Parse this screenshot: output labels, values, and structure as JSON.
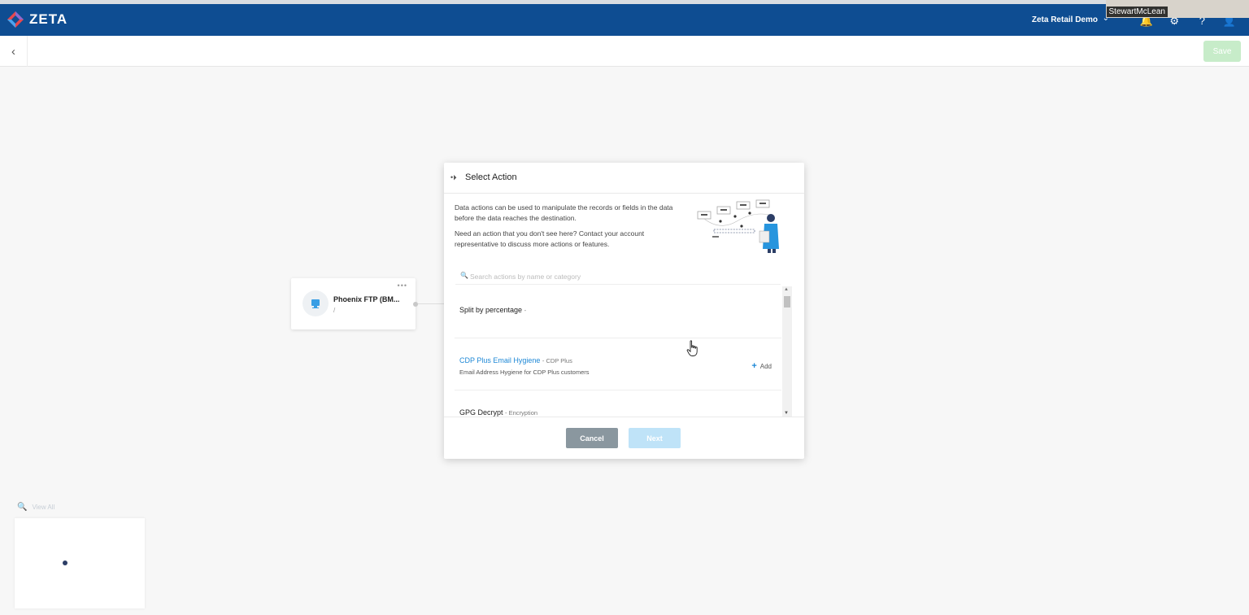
{
  "header": {
    "logo_text": "ZETA",
    "org_name": "Zeta Retail Demo",
    "video_participant": "StewartMcLean"
  },
  "toolbar": {
    "save_label": "Save"
  },
  "node": {
    "title": "Phoenix FTP (BM...",
    "subtitle": "/",
    "menu": "•••"
  },
  "modal": {
    "title": "Select Action",
    "description": "Data actions can be used to manipulate the records or fields in the data before the data reaches the destination.",
    "help_text": "Need an action that you don't see here? Contact your account representative to discuss more actions or features.",
    "search_placeholder": "Search actions by name or category",
    "items": [
      {
        "name": "Split by percentage",
        "category": "-",
        "description": ""
      },
      {
        "name": "CDP Plus Email Hygiene",
        "category": "- CDP Plus",
        "description": "Email Address Hygiene for CDP Plus customers",
        "add_label": "Add"
      },
      {
        "name": "GPG Decrypt",
        "category": "- Encryption",
        "description": ""
      }
    ],
    "cancel_label": "Cancel",
    "next_label": "Next"
  },
  "minimap": {
    "view_all_label": "View All"
  },
  "colors": {
    "header_bg": "#0e4d92",
    "link": "#1e88d6",
    "save_disabled": "#c7ecc9",
    "cancel_bg": "#8a979f",
    "next_disabled": "#bfe3f8"
  }
}
